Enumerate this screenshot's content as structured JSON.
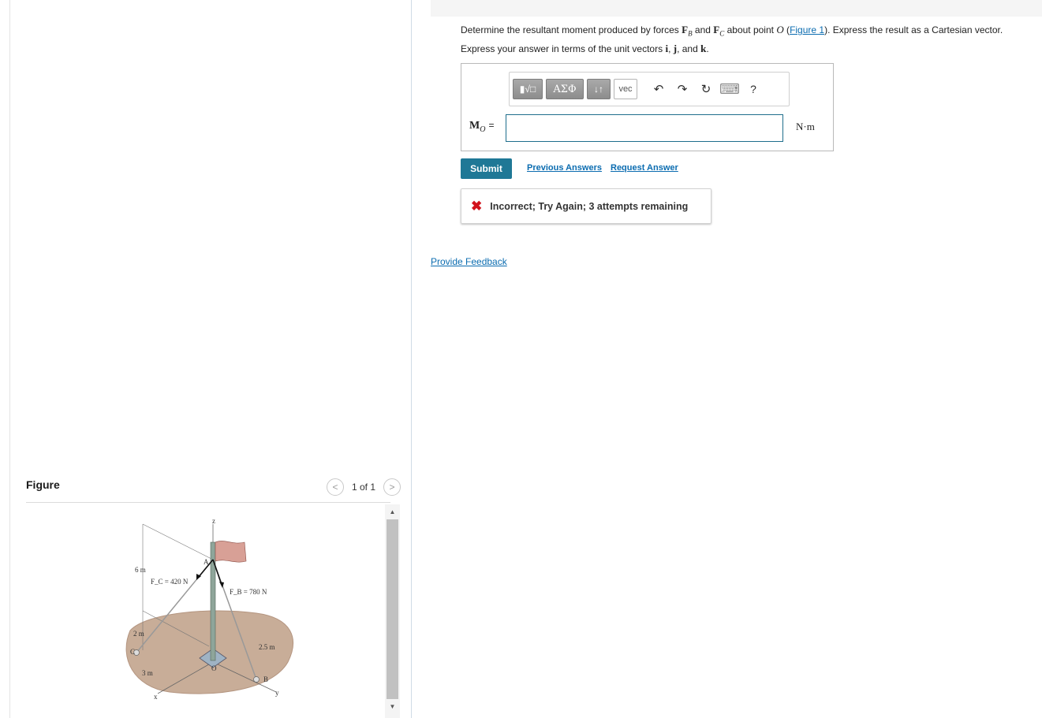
{
  "question": {
    "prefix": "Determine the resultant moment produced by forces ",
    "fb_symbol": "F",
    "fb_sub": "B",
    "and": " and ",
    "fc_symbol": "F",
    "fc_sub": "C",
    "about_point": " about point ",
    "point": "O",
    "open_paren": " (",
    "figure_link": "Figure 1",
    "suffix": "). Express the result as a Cartesian vector."
  },
  "instruction": {
    "prefix": "Express your answer in terms of the unit vectors ",
    "i": "i",
    "comma1": ", ",
    "j": "j",
    "comma2": ", and ",
    "k": "k",
    "end": "."
  },
  "toolbar": {
    "templates_label": "▮√□",
    "greek_label": "ΑΣΦ",
    "sort_label": "↓↑",
    "vec_label": "vec",
    "undo_label": "↶",
    "redo_label": "↷",
    "reset_label": "↻",
    "keyboard_label": "⌨",
    "help_label": "?"
  },
  "answer": {
    "variable": "M",
    "variable_sub": "O",
    "equals": "=",
    "value": "",
    "unit": "N·m"
  },
  "actions": {
    "submit": "Submit",
    "previous_answers": "Previous Answers",
    "request_answer": "Request Answer"
  },
  "feedback": {
    "icon": "✖",
    "message": "Incorrect; Try Again; 3 attempts remaining"
  },
  "provide_feedback": "Provide Feedback",
  "figure": {
    "title": "Figure",
    "pager_prev": "<",
    "pager_count": "1 of 1",
    "pager_next": ">",
    "labels": {
      "z": "z",
      "a": "A",
      "six_m": "6 m",
      "fc": "F_C = 420 N",
      "fb": "F_B = 780 N",
      "two_m": "2 m",
      "c": "C",
      "two_five_m": "2.5 m",
      "o": "O",
      "b": "B",
      "three_m": "3 m",
      "x": "x",
      "y": "y"
    }
  },
  "colors": {
    "submit_bg": "#1f7896",
    "link": "#0b6cb0",
    "error": "#d1121b",
    "input_border": "#1f6e8c"
  }
}
